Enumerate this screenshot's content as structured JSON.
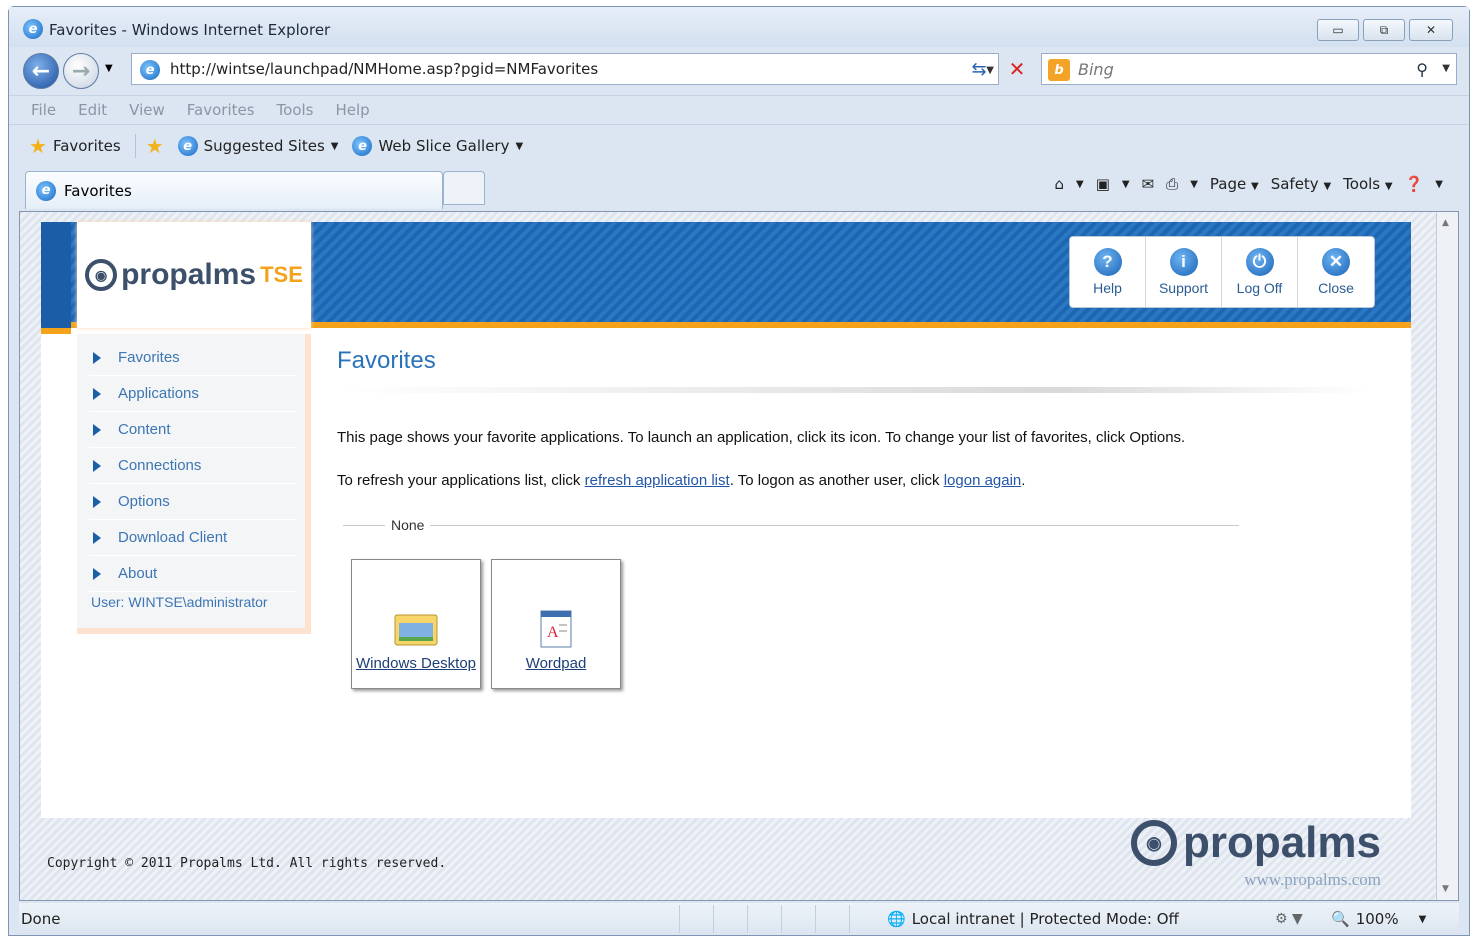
{
  "window": {
    "title": "Favorites - Windows Internet Explorer",
    "address": "http://wintse/launchpad/NMHome.asp?pgid=NMFavorites",
    "search_placeholder": "Bing"
  },
  "menu": [
    "File",
    "Edit",
    "View",
    "Favorites",
    "Tools",
    "Help"
  ],
  "favbar": {
    "favorites": "Favorites",
    "suggested": "Suggested Sites",
    "webslice": "Web Slice Gallery"
  },
  "tab": {
    "label": "Favorites"
  },
  "cmdbar": {
    "page": "Page",
    "safety": "Safety",
    "tools": "Tools"
  },
  "app": {
    "logo": "propalms",
    "logo_suffix": "TSE",
    "buttons": [
      "Help",
      "Support",
      "Log Off",
      "Close"
    ],
    "sidebar": [
      "Favorites",
      "Applications",
      "Content",
      "Connections",
      "Options",
      "Download Client",
      "About"
    ],
    "user": "User: WINTSE\\administrator",
    "heading": "Favorites",
    "para1": "This page shows your favorite applications. To launch an application, click its icon. To change your list of favorites, click Options.",
    "para2_pre": "To refresh your applications list, click ",
    "para2_link1": "refresh application list",
    "para2_mid": ". To logon as another user, click ",
    "para2_link2": "logon again",
    "para2_post": ".",
    "group_label": "None",
    "tiles": [
      "Windows Desktop",
      "Wordpad"
    ],
    "copyright": "Copyright © 2011 Propalms Ltd. All rights reserved.",
    "footer_logo": "propalms",
    "footer_url": "www.propalms.com"
  },
  "status": {
    "left": "Done",
    "zone": "Local intranet | Protected Mode: Off",
    "zoom": "100%"
  }
}
